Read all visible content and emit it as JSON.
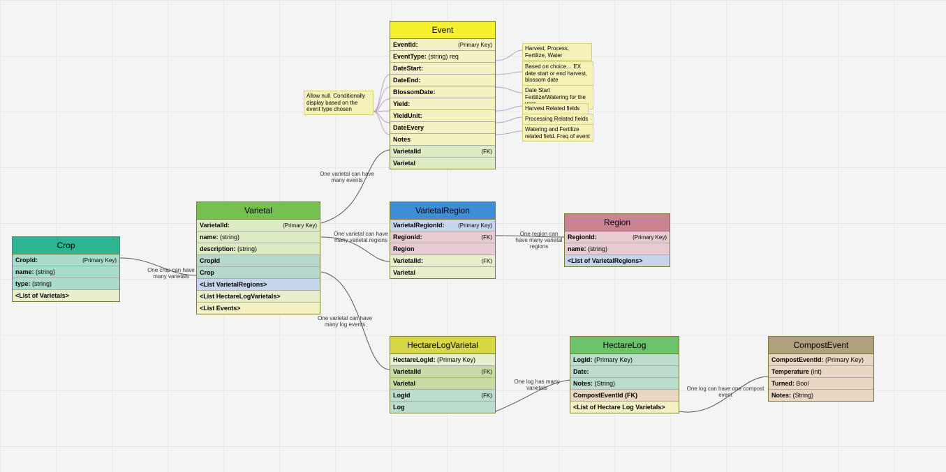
{
  "entities": {
    "crop": {
      "title": "Crop",
      "rows": [
        {
          "k": "CropId:",
          "r": "(Primary Key)",
          "bg": "#a9dccd"
        },
        {
          "k": "name:",
          "m": "(string)",
          "bg": "#a9dccd"
        },
        {
          "k": "type:",
          "m": "(string)",
          "bg": "#a9dccd"
        },
        {
          "k": "<List of Varietals>",
          "bg": "#e6eecb"
        }
      ],
      "headerBg": "#2db591"
    },
    "varietal": {
      "title": "Varietal",
      "rows": [
        {
          "k": "VarietalId:",
          "r": "(Primary Key)",
          "bg": "#ddebc5"
        },
        {
          "k": "name:",
          "m": "(string)",
          "bg": "#ddebc5"
        },
        {
          "k": "description:",
          "m": "(string)",
          "bg": "#ddebc5"
        },
        {
          "k": "CropId",
          "bg": "#b5d8ca"
        },
        {
          "k": "Crop",
          "bg": "#b5d8ca"
        },
        {
          "k": "<List VarietalRegions>",
          "bg": "#c6d5ea"
        },
        {
          "k": "<List HectareLogVarietals>",
          "bg": "#e6eecb"
        },
        {
          "k": "<List Events>",
          "bg": "#f4f1c3"
        }
      ],
      "headerBg": "#74c050"
    },
    "event": {
      "title": "Event",
      "rows": [
        {
          "k": "EventId:",
          "r": "(Primary Key)",
          "bg": "#f4f1c3"
        },
        {
          "k": "EventType:",
          "m": "(string) req",
          "bg": "#f4f1c3"
        },
        {
          "k": "DateStart:",
          "bg": "#f4f1c3"
        },
        {
          "k": "DateEnd:",
          "bg": "#f4f1c3"
        },
        {
          "k": "BlossomDate:",
          "bg": "#f4f1c3"
        },
        {
          "k": "Yield:",
          "bg": "#f4f1c3"
        },
        {
          "k": "YieldUnit:",
          "bg": "#f4f1c3"
        },
        {
          "k": "DateEvery",
          "bg": "#f4f1c3"
        },
        {
          "k": "Notes",
          "bg": "#f4f1c3"
        },
        {
          "k": "VarietalId",
          "r": "(FK)",
          "bg": "#ddebc5"
        },
        {
          "k": "Varietal",
          "bg": "#ddebc5"
        }
      ],
      "headerBg": "#f7f02e"
    },
    "varietalRegion": {
      "title": "VarietalRegion",
      "rows": [
        {
          "k": "VarietalRegionId:",
          "r": "(Primary Key)",
          "bg": "#c6d5ea"
        },
        {
          "k": "RegionId:",
          "r": "(FK)",
          "bg": "#e8cbd0"
        },
        {
          "k": "Region",
          "bg": "#e8cbd0"
        },
        {
          "k": "VarietalId:",
          "r": "(FK)",
          "bg": "#e6eecb"
        },
        {
          "k": "Varietal",
          "bg": "#e6eecb"
        }
      ],
      "headerBg": "#3f8dd5"
    },
    "region": {
      "title": "Region",
      "rows": [
        {
          "k": "RegionId:",
          "r": "(Primary Key)",
          "bg": "#e8cbd0"
        },
        {
          "k": "name:",
          "m": "(string)",
          "bg": "#e8cbd0"
        },
        {
          "k": "<List of VarietalRegions>",
          "bg": "#c6d5ea"
        }
      ],
      "headerBg": "#ca8392"
    },
    "hectareLogVarietal": {
      "title": "HectareLogVarietal",
      "rows": [
        {
          "k": "HectareLogId:",
          "m": "(Primary Key)",
          "bg": "#e6eecb"
        },
        {
          "k": "VarietalId",
          "r": "(FK)",
          "bg": "#c9dba4"
        },
        {
          "k": "Varietal",
          "bg": "#c9dba4"
        },
        {
          "k": "LogId",
          "r": "(FK)",
          "bg": "#bcdccd"
        },
        {
          "k": "Log",
          "bg": "#bcdccd"
        }
      ],
      "headerBg": "#d6d845"
    },
    "hectareLog": {
      "title": "HectareLog",
      "rows": [
        {
          "k": "LogId:",
          "m": "(Primary Key)",
          "bg": "#bcdccd"
        },
        {
          "k": "Date:",
          "bg": "#bcdccd"
        },
        {
          "k": "Notes:",
          "m": "(String)",
          "bg": "#bcdccd"
        },
        {
          "k": "CompostEventId (FK)",
          "bg": "#ead7c3"
        },
        {
          "k": "<List of Hectare Log Varietals>",
          "bg": "#f2f2c5"
        }
      ],
      "headerBg": "#6bc46b"
    },
    "compostEvent": {
      "title": "CompostEvent",
      "rows": [
        {
          "k": "CompostEventId:",
          "m": "(Primary Key)",
          "bg": "#ead7c3"
        },
        {
          "k": "Temperature",
          "m": "(int)",
          "bg": "#ead7c3"
        },
        {
          "k": "Turned:",
          "m": "Bool",
          "bg": "#ead7c3"
        },
        {
          "k": "Notes:",
          "m": "(String)",
          "bg": "#ead7c3"
        }
      ],
      "headerBg": "#b0a17d"
    }
  },
  "notes": {
    "n1": "Allow null. Conditionally display based on the event type chosen",
    "n2": "Harvest, Process, Fertilize, Water",
    "n3": "Based on choice… EX date start or end harvest, blossom date",
    "n4": "Date Start Fertilize/Watering for the year",
    "n5": "Harvest Related fields",
    "n6": "Processing Related fields",
    "n7": "Watering and Fertilize related field. Freq of event"
  },
  "relLabels": {
    "r1": "One crop can have many varietals",
    "r2": "One varietal can have many events",
    "r3": "One varietal can have many varietal regions",
    "r4": "One varietal can have many log events",
    "r5": "One region can have many varietal regions",
    "r6": "One log has many varietals",
    "r7": "One log can have one compost event"
  }
}
